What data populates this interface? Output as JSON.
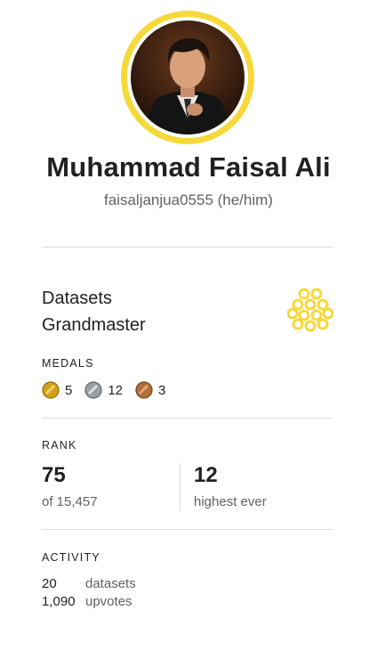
{
  "profile": {
    "name": "Muhammad Faisal Ali",
    "handle": "faisaljanjua0555 (he/him)"
  },
  "tier": {
    "line1": "Datasets",
    "line2": "Grandmaster",
    "badge_color": "#f5d93b"
  },
  "medals": {
    "label": "MEDALS",
    "gold": "5",
    "silver": "12",
    "bronze": "3",
    "colors": {
      "gold": "#d4a017",
      "silver": "#9aa0a6",
      "bronze": "#b0703a"
    }
  },
  "rank": {
    "label": "RANK",
    "current": "75",
    "current_sub": "of 15,457",
    "highest": "12",
    "highest_sub": "highest ever"
  },
  "activity": {
    "label": "ACTIVITY",
    "rows": [
      {
        "count": "20",
        "label": "datasets"
      },
      {
        "count": "1,090",
        "label": "upvotes"
      }
    ]
  },
  "colors": {
    "accent": "#f5d93b",
    "divider": "#dadce0",
    "muted": "#5f6368"
  }
}
